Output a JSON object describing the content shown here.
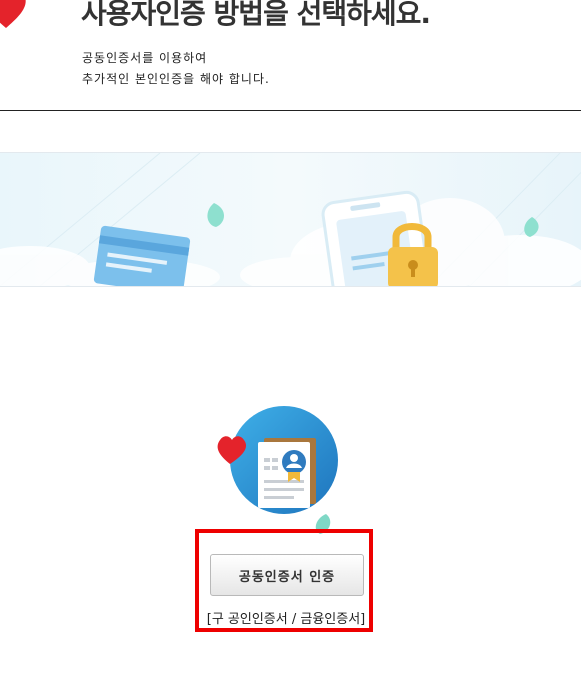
{
  "header": {
    "title": "사용자인증 방법을 선택하세요.",
    "description_line1": "공동인증서를 이용하여",
    "description_line2": "추가적인 본인인증을 해야 합니다."
  },
  "certificate": {
    "button_label": "공동인증서 인증",
    "note": "[구 공인인증서 / 금융인증서]"
  },
  "colors": {
    "accent_red": "#e4232b",
    "highlight_red": "#ee0000",
    "sky_blue": "#4aa6dd",
    "lock_yellow": "#f4c24a",
    "leaf_mint": "#6fd3c2"
  }
}
